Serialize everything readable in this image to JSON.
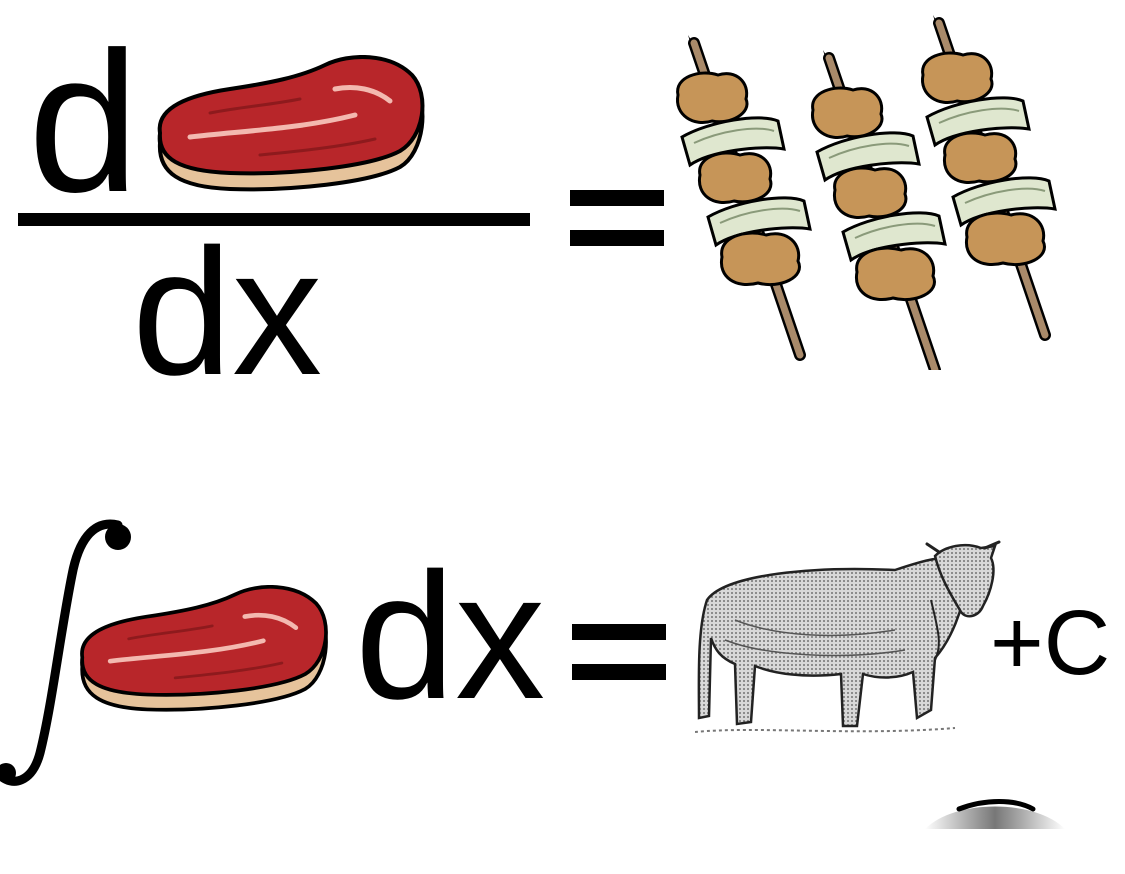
{
  "derivative_equation": {
    "numerator": "d",
    "denominator": "dx",
    "equals": "=",
    "operand_icon": "steak-icon",
    "result_icon": "kebab-skewers-icon",
    "result_count": 3
  },
  "integral_equation": {
    "integral_sign_icon": "integral-sign-icon",
    "operand_icon": "steak-icon",
    "differential": "dx",
    "equals": "=",
    "result_icon": "cow-icon",
    "constant": "+C"
  },
  "colors": {
    "background": "#ffffff",
    "text": "#000000",
    "meat_red": "#b8262a",
    "meat_dark": "#8e1a1d",
    "fat_pink": "#f3b9b0",
    "crust_tan": "#e6c39b",
    "kebab_meat": "#c69558",
    "kebab_onion": "#dfe7cf",
    "skewer": "#a98a6a"
  }
}
